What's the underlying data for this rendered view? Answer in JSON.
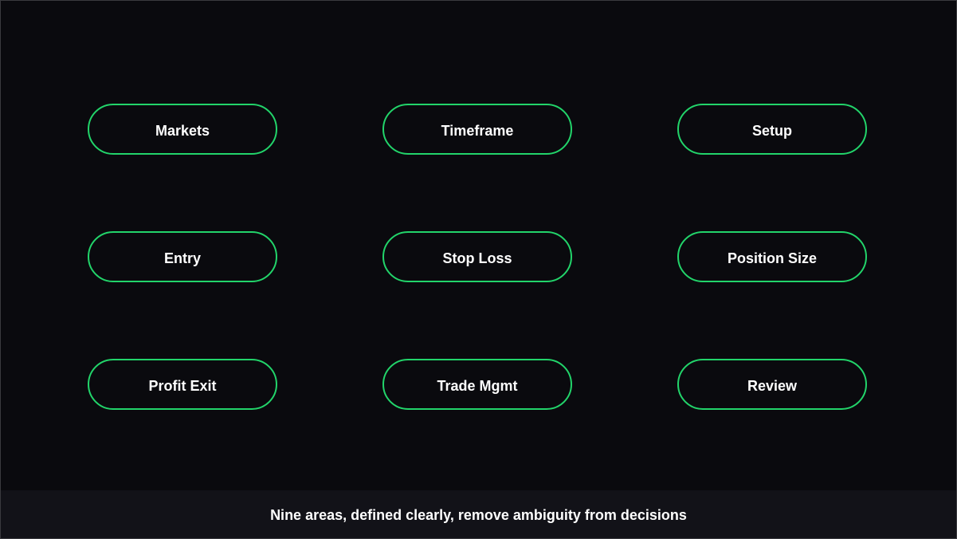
{
  "diagram": {
    "nodes": [
      {
        "label": "Markets"
      },
      {
        "label": "Timeframe"
      },
      {
        "label": "Setup"
      },
      {
        "label": "Entry"
      },
      {
        "label": "Stop Loss"
      },
      {
        "label": "Position Size"
      },
      {
        "label": "Profit Exit"
      },
      {
        "label": "Trade Mgmt"
      },
      {
        "label": "Review"
      }
    ],
    "caption": "Nine areas, defined clearly, remove ambiguity from decisions"
  },
  "colors": {
    "background": "#0a0a0e",
    "footer_background": "#121218",
    "accent": "#22d46a",
    "text": "#ffffff"
  }
}
